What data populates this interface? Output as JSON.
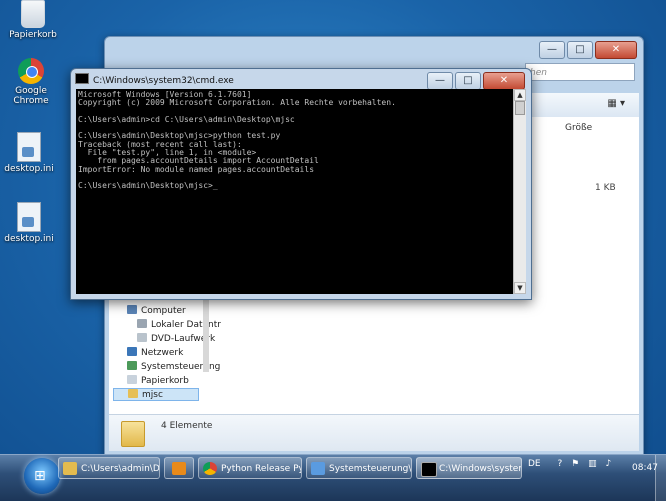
{
  "desktop": {
    "icons": [
      {
        "label": "Papierkorb",
        "icon": "recycle-bin-icon"
      },
      {
        "label": "Google Chrome",
        "icon": "chrome-icon"
      },
      {
        "label": "desktop.ini",
        "icon": "ini-file-icon"
      },
      {
        "label": "desktop.ini",
        "icon": "ini-file-icon"
      }
    ]
  },
  "explorer": {
    "search_placeholder": "hen",
    "column_header": "Größe",
    "file_size": "1 KB",
    "status_text": "4 Elemente",
    "view_glyph": "▦ ▾",
    "nav_items": [
      "Computer",
      "Lokaler Datentr",
      "DVD-Laufwerk",
      "Netzwerk",
      "Systemsteuerung",
      "Papierkorb",
      "mjsc"
    ]
  },
  "cmd": {
    "title": "C:\\Windows\\system32\\cmd.exe",
    "lines": [
      "Microsoft Windows [Version 6.1.7601]",
      "Copyright (c) 2009 Microsoft Corporation. Alle Rechte vorbehalten.",
      "",
      "C:\\Users\\admin>cd C:\\Users\\admin\\Desktop\\mjsc",
      "",
      "C:\\Users\\admin\\Desktop\\mjsc>python test.py",
      "Traceback (most recent call last):",
      "  File \"test.py\", line 1, in <module>",
      "    from pages.accountDetails import AccountDetail",
      "ImportError: No module named pages.accountDetails",
      "",
      "C:\\Users\\admin\\Desktop\\mjsc>_"
    ]
  },
  "window_controls": {
    "minimize": "—",
    "maximize": "□",
    "close": "✕"
  },
  "taskbar": {
    "tasks": [
      {
        "label": "C:\\Users\\admin\\Des...",
        "icon": "folder-icon"
      },
      {
        "label": "",
        "icon": "media-player-icon"
      },
      {
        "label": "Python Release Pyth...",
        "icon": "chrome-icon"
      },
      {
        "label": "Systemsteuerung\\All...",
        "icon": "control-panel-icon"
      },
      {
        "label": "C:\\Windows\\system...",
        "icon": "cmd-icon"
      }
    ],
    "language": "DE",
    "clock": "08:47"
  }
}
